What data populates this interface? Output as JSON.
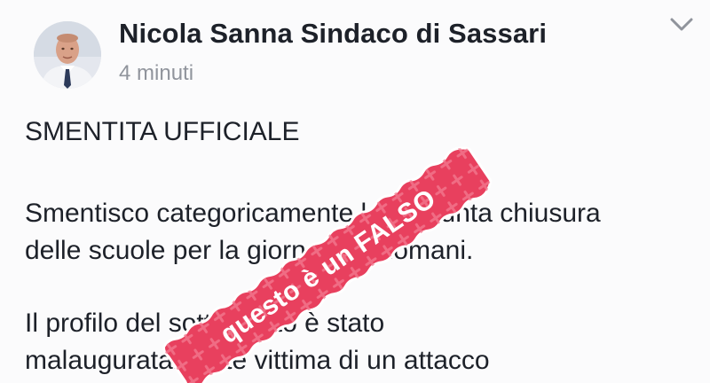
{
  "post": {
    "author": "Nicola Sanna Sindaco di Sassari",
    "timestamp": "4 minuti",
    "menu_icon": "chevron-down-icon",
    "heading": "SMENTITA UFFICIALE",
    "paragraph_1": [
      "Smentisco categoricamente la presunta chiusura",
      "delle scuole per la giornata di domani."
    ],
    "paragraph_2": [
      "Il profilo del sottoscritto è stato",
      "malauguratamente vittima di un attacco"
    ]
  },
  "stamp": {
    "text": "questo è un FALSO",
    "color": "#e8405e",
    "border_color": "#ffffff"
  }
}
